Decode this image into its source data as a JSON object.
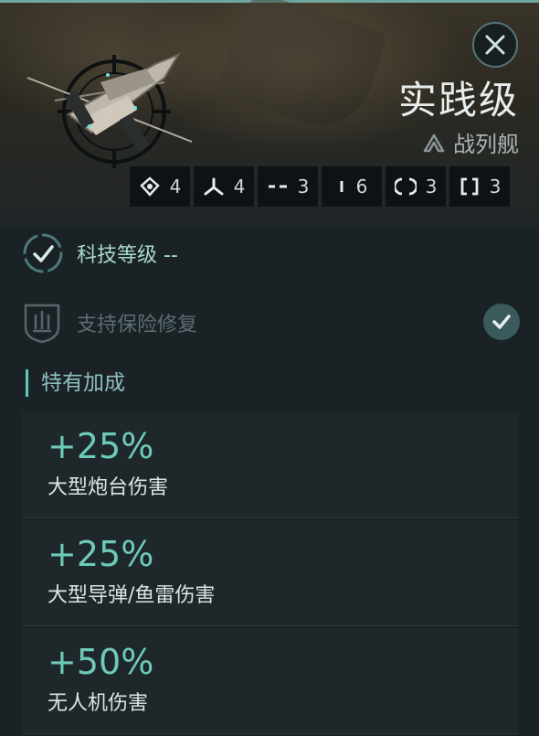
{
  "ship": {
    "name": "实践级",
    "class_label": "战列舰",
    "class_icon": "battleship-chevron-icon"
  },
  "close": {
    "icon": "close-icon"
  },
  "slots": [
    {
      "icon": "turret-slot-icon",
      "value": "4"
    },
    {
      "icon": "drone-slot-icon",
      "value": "4"
    },
    {
      "icon": "low-slot-icon",
      "value": "3"
    },
    {
      "icon": "high-slot-icon",
      "value": "6"
    },
    {
      "icon": "mid-slot-icon",
      "value": "3"
    },
    {
      "icon": "rig-slot-icon",
      "value": "3"
    }
  ],
  "tech": {
    "label": "科技等级 --"
  },
  "insurance": {
    "label": "支持保险修复",
    "checked": true
  },
  "section": {
    "title": "特有加成"
  },
  "bonuses": [
    {
      "value": "+25%",
      "label": "大型炮台伤害"
    },
    {
      "value": "+25%",
      "label": "大型导弹/鱼雷伤害"
    },
    {
      "value": "+50%",
      "label": "无人机伤害"
    }
  ],
  "colors": {
    "accent": "#6ecab8",
    "background": "#1a2226",
    "panel": "#1e282b"
  }
}
